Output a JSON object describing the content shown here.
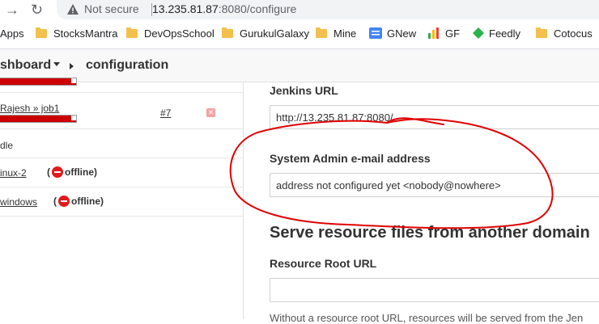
{
  "browser": {
    "security_label": "Not secure",
    "url_host": "13.235.81.87",
    "url_path": ":8080/configure"
  },
  "bookmarks": [
    {
      "label": "Apps",
      "icon": "apps-grid-icon"
    },
    {
      "label": "StocksMantra",
      "icon": "folder-icon"
    },
    {
      "label": "DevOpsSchool",
      "icon": "folder-icon"
    },
    {
      "label": "GurukulGalaxy",
      "icon": "folder-icon"
    },
    {
      "label": "Mine",
      "icon": "folder-icon"
    },
    {
      "label": "GNew",
      "icon": "gnew-icon"
    },
    {
      "label": "GF",
      "icon": "gf-icon"
    },
    {
      "label": "Feedly",
      "icon": "feedly-icon"
    },
    {
      "label": "Cotocus",
      "icon": "folder-icon"
    }
  ],
  "breadcrumb": {
    "dashboard": "shboard",
    "current": "configuration"
  },
  "executors": {
    "job_link": "Rajesh » job1",
    "build_number": "#7",
    "idle_text": "dle",
    "nodes": [
      {
        "name": "inux-2",
        "status": "offline"
      },
      {
        "name": "windows",
        "status": "offline"
      }
    ]
  },
  "config": {
    "jenkins_url_label": "Jenkins URL",
    "jenkins_url_value": "http://13.235.81.87:8080/",
    "admin_email_label": "System Admin e-mail address",
    "admin_email_value": "address not configured yet <nobody@nowhere>",
    "resource_section_title": "Serve resource files from another domain",
    "resource_root_label": "Resource Root URL",
    "resource_root_value": "",
    "help_text": "Without a resource root URL, resources will be served from the Jen"
  },
  "colors": {
    "annotation": "#e00000",
    "progress": "#cc0000",
    "offline": "#e01b1b"
  }
}
